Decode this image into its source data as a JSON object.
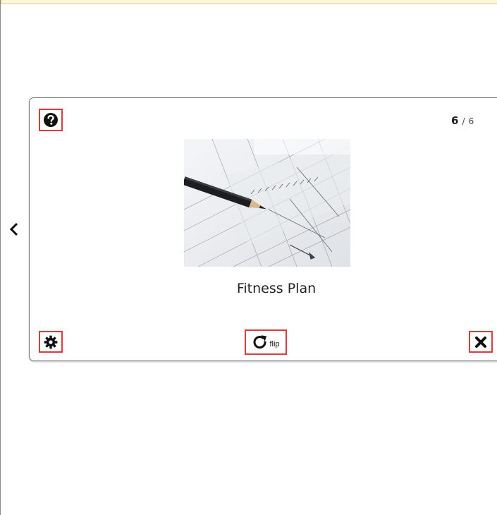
{
  "card": {
    "title": "Fitness Plan",
    "counter_current": "6",
    "counter_separator": "/",
    "counter_total": "6",
    "image_icon": "pencil-on-blueprint-image"
  },
  "controls": {
    "help_icon": "question-circle-icon",
    "settings_icon": "gear-icon",
    "flip_icon": "rotate-right-icon",
    "flip_label": "flip",
    "close_icon": "close-icon",
    "prev_icon": "chevron-left-icon"
  },
  "colors": {
    "highlight_border": "#e23a3a",
    "banner": "#fdf7d9",
    "card_border": "#7a7a7a"
  }
}
